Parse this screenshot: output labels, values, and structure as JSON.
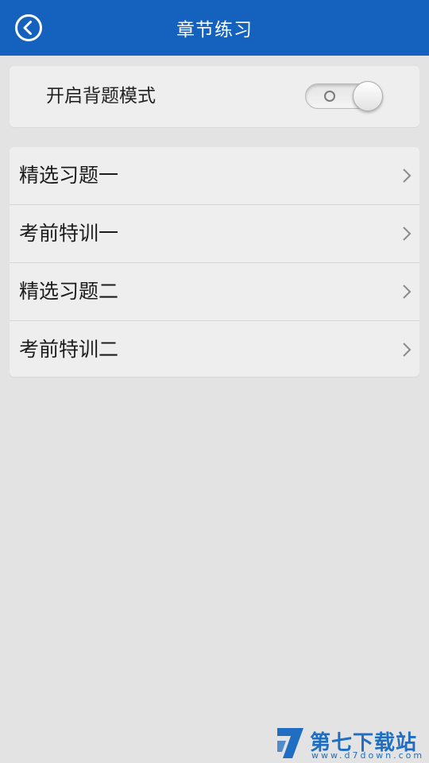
{
  "header": {
    "title": "章节练习"
  },
  "recite_mode": {
    "label": "开启背题模式",
    "enabled": false
  },
  "list": {
    "items": [
      {
        "label": "精选习题一"
      },
      {
        "label": "考前特训一"
      },
      {
        "label": "精选习题二"
      },
      {
        "label": "考前特训二"
      }
    ]
  },
  "watermark": {
    "name": "第七下载站",
    "url": "www.d7down.com"
  },
  "colors": {
    "header": "#1462bd",
    "background": "#e3e3e3",
    "card": "#eeeeee"
  },
  "icons": {
    "back": "back-arrow-circle-icon",
    "chevron": "chevron-right-icon",
    "logo": "d7-logo-icon"
  }
}
